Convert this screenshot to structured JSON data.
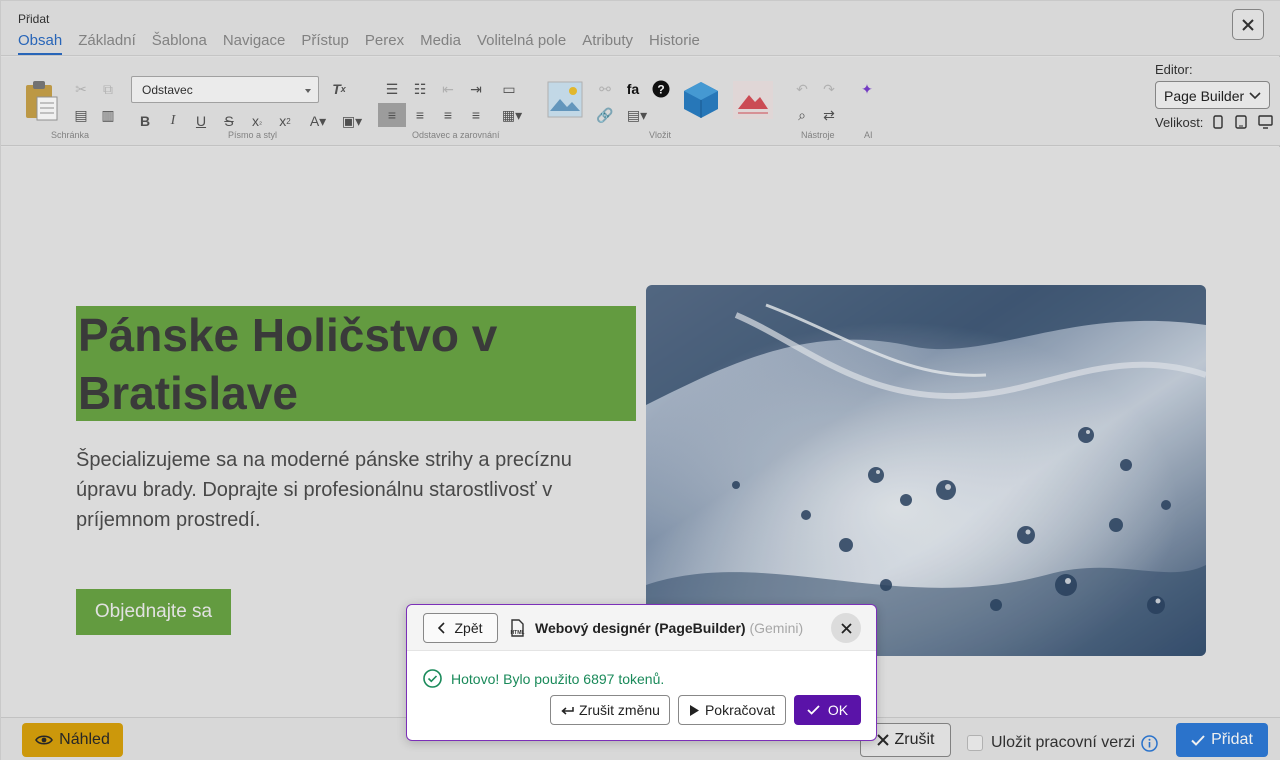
{
  "window": {
    "title": "Přidat"
  },
  "tabs": [
    "Obsah",
    "Základní",
    "Šablona",
    "Navigace",
    "Přístup",
    "Perex",
    "Media",
    "Volitelná pole",
    "Atributy",
    "Historie"
  ],
  "toolbar": {
    "format_select": "Odstavec",
    "groups": [
      "Schránka",
      "Písmo a styl",
      "Odstavec a zarovnání",
      "Vložit",
      "Nástroje",
      "AI"
    ],
    "editor_label": "Editor:",
    "editor_value": "Page Builder",
    "size_label": "Velikost:"
  },
  "page": {
    "hero_title": "Pánske Holičstvo v Bratislave",
    "hero_text": "Špecializujeme sa na moderné pánske strihy a precíznu úpravu brady. Doprajte si profesionálnu starostlivosť v príjemnom prostredí.",
    "cta": "Objednajte sa"
  },
  "footer": {
    "preview": "Náhled",
    "cancel": "Zrušit",
    "save_draft": "Uložit pracovní verzi",
    "add": "Přidat"
  },
  "dialog": {
    "back": "Zpět",
    "title": "Webový designér (PageBuilder)",
    "subtitle": "(Gemini)",
    "status": "Hotovo! Bylo použito 6897 tokenů.",
    "undo": "Zrušit změnu",
    "continue": "Pokračovat",
    "ok": "OK"
  },
  "colors": {
    "accent": "#2b6cc4",
    "hero_green": "#6aa544",
    "dialog_purple": "#5a13a8",
    "preview_yellow": "#d9a20c"
  }
}
